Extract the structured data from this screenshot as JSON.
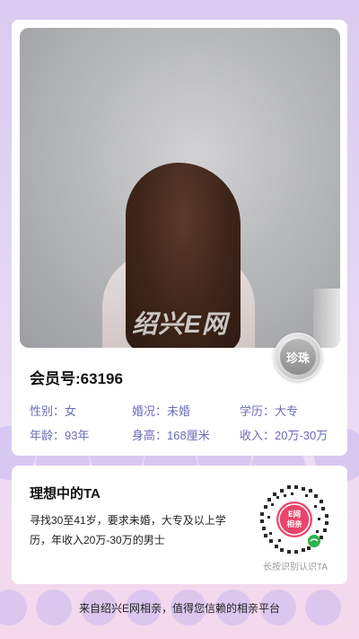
{
  "profile": {
    "photo_watermark": "绍兴E网",
    "badge_label": "珍珠",
    "member_label": "会员号:63196",
    "info_rows": [
      [
        "性别：女",
        "婚况：未婚",
        "学历：大专"
      ],
      [
        "年龄：93年",
        "身高：168厘米",
        "收入：20万-30万"
      ]
    ]
  },
  "ideal": {
    "title": "理想中的TA",
    "description": "寻找30至41岁，要求未婚，大专及以上学历，年收入20万-30万的男士",
    "qr_logo_text": "E网相亲",
    "qr_caption": "长按识别认识TA"
  },
  "footer": {
    "text": "来自绍兴E网相亲，值得您信赖的相亲平台"
  },
  "colors": {
    "background": "#dcd0f2",
    "info_text": "#6b6bbb",
    "qr_brand": "#e9446a",
    "badge": "#a8a8a8"
  }
}
